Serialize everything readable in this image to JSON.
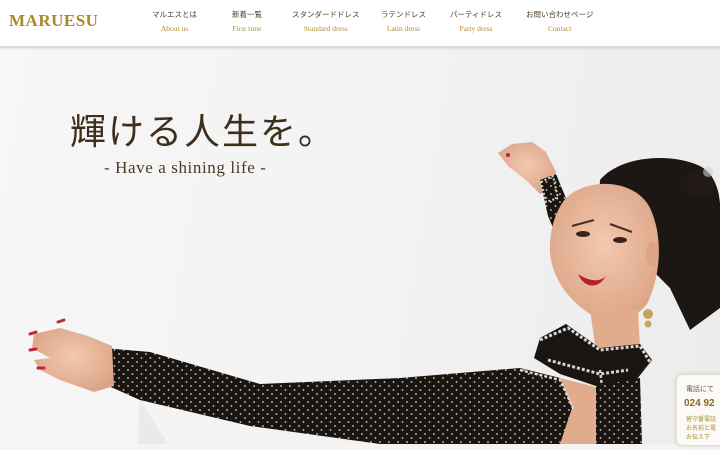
{
  "header": {
    "logo": "MARUESU",
    "nav": [
      {
        "ja": "マルエスとは",
        "en": "About us"
      },
      {
        "ja": "新着一覧",
        "en": "First time"
      },
      {
        "ja": "スタンダードドレス",
        "en": "Standard dress"
      },
      {
        "ja": "ラテンドレス",
        "en": "Latin dress"
      },
      {
        "ja": "パーティドレス",
        "en": "Party dress"
      },
      {
        "ja": "お問い合わせページ",
        "en": "Contact"
      }
    ]
  },
  "hero": {
    "title": "輝ける人生を。",
    "subtitle": "- Have a shining life -"
  },
  "contact_box": {
    "label": "電話にて",
    "phone": "024 92",
    "note_lines": [
      "留守番電話",
      "お名前と電",
      "お伝え下"
    ]
  },
  "colors": {
    "gold": "#a8892a",
    "brown_text": "#3e2f1c",
    "dress_black": "#1b1512"
  }
}
